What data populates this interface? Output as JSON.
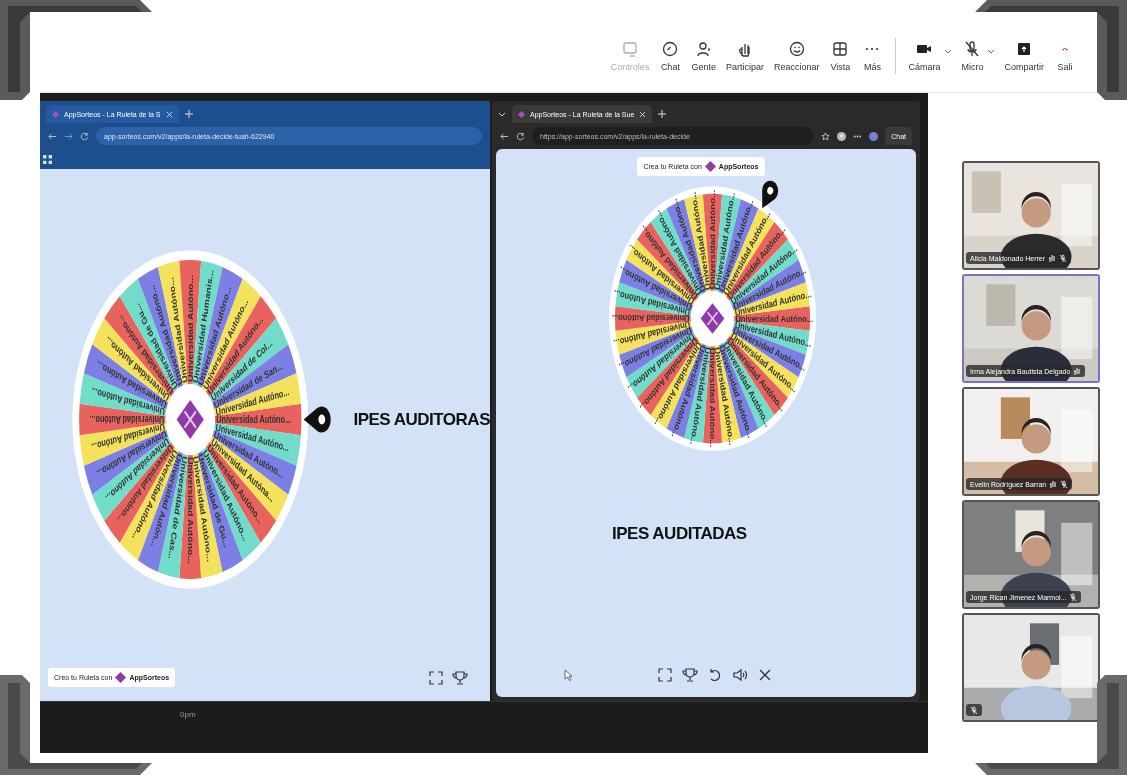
{
  "meeting_toolbar": {
    "items": [
      {
        "label": "Controles",
        "disabled": true,
        "dropdown": false
      },
      {
        "label": "Chat",
        "disabled": false,
        "dropdown": false
      },
      {
        "label": "Gente",
        "disabled": false,
        "dropdown": false
      },
      {
        "label": "Participar",
        "disabled": false,
        "dropdown": false
      },
      {
        "label": "Reaccionar",
        "disabled": false,
        "dropdown": false
      },
      {
        "label": "Vista",
        "disabled": false,
        "dropdown": false
      },
      {
        "label": "Más",
        "disabled": false,
        "dropdown": false
      },
      {
        "label": "Cámara",
        "disabled": false,
        "dropdown": true
      },
      {
        "label": "Micro",
        "disabled": false,
        "dropdown": true
      },
      {
        "label": "Compartir",
        "disabled": false,
        "dropdown": false
      },
      {
        "label": "Sali",
        "disabled": false,
        "dropdown": false
      }
    ]
  },
  "left_browser": {
    "tab_title": "AppSorteos - La Ruleta de la S",
    "url": "app-sorteos.com/v2/apps/la-ruleta-decide-tuah-622940",
    "wheel": {
      "segments": [
        {
          "label": "Universidad Autóno..."
        },
        {
          "label": "Universidad Autóno..."
        },
        {
          "label": "Universidad Autóno..."
        },
        {
          "label": "Universidad Autóna..."
        },
        {
          "label": "Universidad Autóno..."
        },
        {
          "label": "Universidad Autóno..."
        },
        {
          "label": "Universidad de Gu..."
        },
        {
          "label": "Universidad Autóno..."
        },
        {
          "label": "Universidad Autóno..."
        },
        {
          "label": "Universidad de Cas..."
        },
        {
          "label": "Universidad Autón..."
        },
        {
          "label": "Universidad Autóno..."
        },
        {
          "label": "Universidad Autóno..."
        },
        {
          "label": "Universidad Autóno..."
        },
        {
          "label": "Universidad Autóno..."
        },
        {
          "label": "Universidad Autóno..."
        },
        {
          "label": "Universidad Autóno..."
        },
        {
          "label": "Universidad Autóno..."
        },
        {
          "label": "Universidad Autóno..."
        },
        {
          "label": "Universidad Autóno..."
        },
        {
          "label": "Universidad Autóno..."
        },
        {
          "label": "Universidad de Gu..."
        },
        {
          "label": "Universidad Autóno..."
        },
        {
          "label": "Universidad Autóno..."
        },
        {
          "label": "Universidad Autóno..."
        },
        {
          "label": "Universidad Humanis..."
        },
        {
          "label": "Universidad Autóno..."
        },
        {
          "label": "Universidad Autóno..."
        },
        {
          "label": "Universidad Autóno..."
        },
        {
          "label": "Universidad de Col..."
        },
        {
          "label": "Universidad de San..."
        },
        {
          "label": "Universidad Autóno..."
        }
      ]
    },
    "result_label": "IPES AUDITORAS",
    "badge": {
      "prefix": "Creo tu Ruleta con",
      "brand": "AppSorteos"
    }
  },
  "right_browser": {
    "tab_title": "AppSorteos - La Ruleta de la Sue",
    "url": "https://app-sorteos.com/v2/apps/la-ruleta-decide",
    "profile_label": "Chat",
    "badge": {
      "prefix": "Crea tu Ruleta con",
      "brand": "AppSorteos"
    },
    "wheel": {
      "segments": [
        {
          "label": "Universidad Autóno..."
        },
        {
          "label": "Universidad Autóno..."
        },
        {
          "label": "Universidad Autóno..."
        },
        {
          "label": "Universidad Autóno..."
        },
        {
          "label": "Universidad Autóno..."
        },
        {
          "label": "Universidad Autóno..."
        },
        {
          "label": "Universidad Autóno..."
        },
        {
          "label": "Universidad Autóno..."
        },
        {
          "label": "Universidad Autóno..."
        },
        {
          "label": "Universidad Autóno..."
        },
        {
          "label": "Universidad Autóno..."
        },
        {
          "label": "Universidad Autóno..."
        },
        {
          "label": "Universidad Autóno..."
        },
        {
          "label": "Universidad Autóno..."
        },
        {
          "label": "Universidad Autóno..."
        },
        {
          "label": "Universidad Autóno..."
        },
        {
          "label": "Universidad Autóno..."
        },
        {
          "label": "Universidad Autóno..."
        },
        {
          "label": "Universidad Autóno..."
        },
        {
          "label": "Universidad Autóno..."
        },
        {
          "label": "Universidad Autóno..."
        },
        {
          "label": "Universidad Autóno..."
        },
        {
          "label": "Universidad Autóno..."
        },
        {
          "label": "Universidad Autóno..."
        },
        {
          "label": "Universidad Autóno..."
        },
        {
          "label": "Universidad Autóno..."
        },
        {
          "label": "Universidad Autóno..."
        },
        {
          "label": "Universidad Autóno..."
        },
        {
          "label": "Universidad Autóno..."
        },
        {
          "label": "Universidad Autóno..."
        },
        {
          "label": "Universidad Autóno..."
        },
        {
          "label": "Universidad Autóno..."
        }
      ]
    },
    "result_label": "IPES AUDITADAS"
  },
  "taskbar_strip": {
    "time": "0pm"
  },
  "participants": [
    {
      "name": "Alicia Maldonado Herrer",
      "speaking": false,
      "hand": true,
      "muted": true
    },
    {
      "name": "Irma Alejandra Bautista Delgado",
      "speaking": true,
      "hand": true,
      "muted": false
    },
    {
      "name": "Evelin Rodríguez Barran",
      "speaking": false,
      "hand": true,
      "muted": true
    },
    {
      "name": "Jorge Rican Jimenez Marmol...",
      "speaking": false,
      "hand": false,
      "muted": true
    },
    {
      "speaking": false,
      "hand": false,
      "muted": true
    }
  ]
}
